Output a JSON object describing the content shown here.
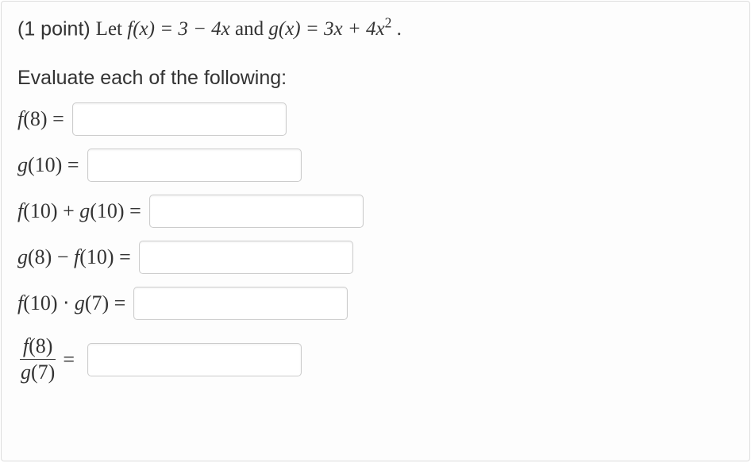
{
  "points_prefix": "(1 point)",
  "stmt_let": "Let",
  "stmt_f": "f(x) = 3 − 4x",
  "stmt_and": "and",
  "stmt_g": "g(x) = 3x + 4x",
  "stmt_exp": "2",
  "stmt_period": " .",
  "instruction": "Evaluate each of the following:",
  "rows": {
    "r1": {
      "prefix": "f",
      "arg": "(8)",
      "eq": " ="
    },
    "r2": {
      "prefix": "g",
      "arg": "(10)",
      "eq": " ="
    },
    "r3": {
      "a_func": "f",
      "a_arg": "(10)",
      "op": " + ",
      "b_func": "g",
      "b_arg": "(10)",
      "eq": " ="
    },
    "r4": {
      "a_func": "g",
      "a_arg": "(8)",
      "op": " − ",
      "b_func": "f",
      "b_arg": "(10)",
      "eq": " ="
    },
    "r5": {
      "a_func": "f",
      "a_arg": "(10)",
      "op": " ⋅ ",
      "b_func": "g",
      "b_arg": "(7)",
      "eq": " ="
    },
    "r6": {
      "num_func": "f",
      "num_arg": "(8)",
      "den_func": "g",
      "den_arg": "(7)",
      "eq": "="
    }
  },
  "inputs": {
    "a1": "",
    "a2": "",
    "a3": "",
    "a4": "",
    "a5": "",
    "a6": ""
  }
}
